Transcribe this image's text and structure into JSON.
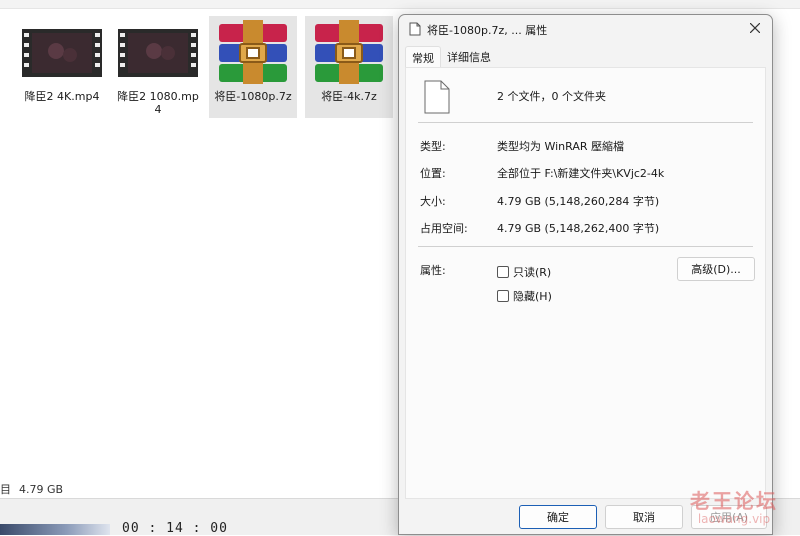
{
  "explorer": {
    "files": [
      {
        "name": "降臣2 4K.mp4",
        "type": "video",
        "selected": false
      },
      {
        "name": "降臣2 1080.mp4",
        "type": "video",
        "selected": false
      },
      {
        "name": "将臣-1080p.7z",
        "type": "archive",
        "selected": true
      },
      {
        "name": "将臣-4k.7z",
        "type": "archive",
        "selected": true
      }
    ],
    "status": {
      "prefix": "目",
      "size": "4.79 GB"
    }
  },
  "taskbar": {
    "time": "00 : 14 : 00"
  },
  "dialog": {
    "title": "将臣-1080p.7z, ... 属性",
    "tabs": [
      "常规",
      "详细信息"
    ],
    "summary": "2 个文件，0 个文件夹",
    "rows": [
      {
        "label": "类型:",
        "value": "类型均为 WinRAR 壓縮檔"
      },
      {
        "label": "位置:",
        "value": "全部位于 F:\\新建文件夹\\KVjc2-4k"
      },
      {
        "label": "大小:",
        "value": "4.79 GB (5,148,260,284 字节)"
      },
      {
        "label": "占用空间:",
        "value": "4.79 GB (5,148,262,400 字节)"
      }
    ],
    "attributes": {
      "label": "属性:",
      "readonly": "只读(R)",
      "hidden": "隐藏(H)",
      "advanced": "高级(D)..."
    },
    "buttons": {
      "ok": "确定",
      "cancel": "取消",
      "apply": "应用(A)"
    }
  },
  "watermark": {
    "text": "老王论坛",
    "url": "laowang.vip"
  },
  "colors": {
    "accent": "#1c5fb5",
    "selection": "#e5e5e5"
  }
}
